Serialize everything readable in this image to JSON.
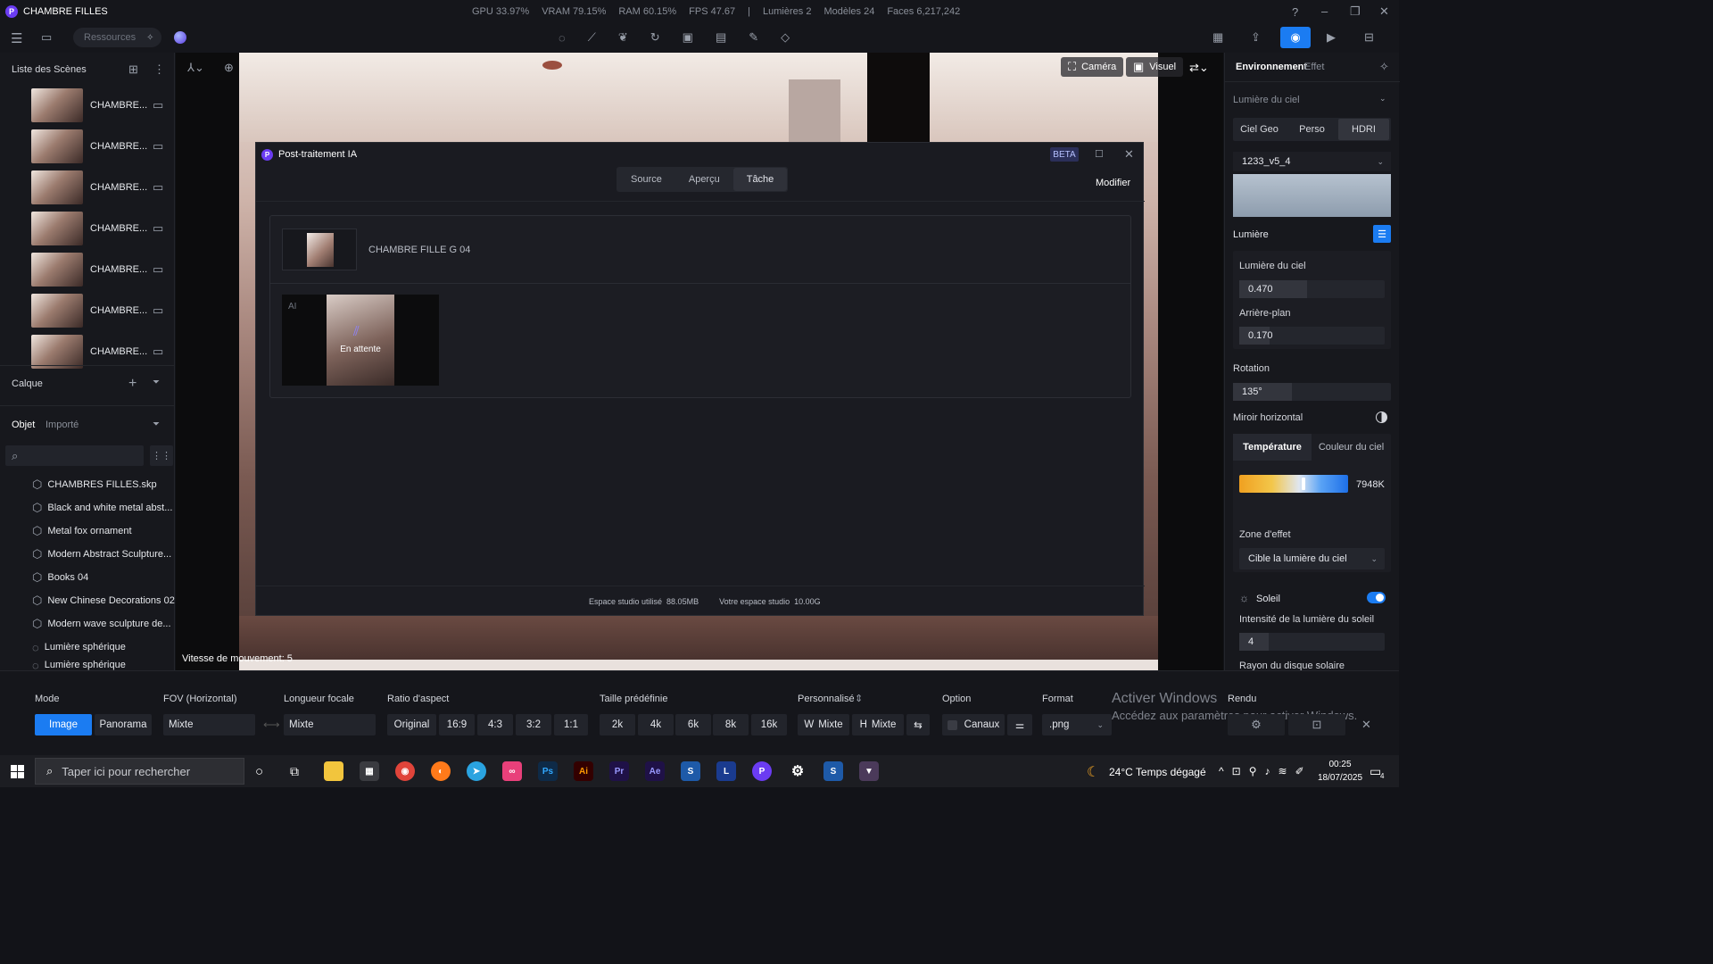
{
  "app": {
    "title": "CHAMBRE FILLES",
    "logo": "P"
  },
  "stats": {
    "gpu": "GPU 33.97%",
    "vram": "VRAM 79.15%",
    "ram": "RAM 60.15%",
    "fps": "FPS 47.67",
    "sep": "|",
    "lights": "Lumières 2",
    "models": "Modèles 24",
    "faces": "Faces 6,217,242"
  },
  "toolbar": {
    "resources_placeholder": "Ressources"
  },
  "scenes": {
    "title": "Liste des Scènes",
    "items": [
      "CHAMBRE...",
      "CHAMBRE...",
      "CHAMBRE...",
      "CHAMBRE...",
      "CHAMBRE...",
      "CHAMBRE...",
      "CHAMBRE..."
    ]
  },
  "layer": {
    "title": "Calque"
  },
  "objects": {
    "tab_object": "Objet",
    "tab_imported": "Importé",
    "items": [
      "CHAMBRES FILLES.skp",
      "Black and white metal abst...",
      "Metal fox ornament",
      "Modern Abstract Sculpture...",
      "Books 04",
      "New Chinese Decorations 02",
      "Modern wave sculpture de...",
      "Lumière sphérique",
      "Lumière sphérique"
    ]
  },
  "viewport": {
    "camera": "Caméra",
    "visual": "Visuel",
    "speed": "Vitesse de mouvement: 5"
  },
  "modal": {
    "title": "Post-traitement IA",
    "badge": "BETA",
    "tabs": [
      "Source",
      "Aperçu",
      "Tâche"
    ],
    "modify": "Modifier",
    "job_name": "CHAMBRE FILLE G 04",
    "ai_label": "AI",
    "status": "En attente",
    "used_label": "Espace studio utilisé",
    "used_value": "88.05MB",
    "total_label": "Votre espace studio",
    "total_value": "10.00G"
  },
  "env": {
    "tab_env": "Environnement",
    "tab_effect": "Effet",
    "sky_light": "Lumière du ciel",
    "sky_tabs": [
      "Ciel Geo",
      "Perso",
      "HDRI"
    ],
    "hdri_name": "1233_v5_4",
    "light": "Lumière",
    "sky_light_label": "Lumière du ciel",
    "sky_light_value": "0.470",
    "background_label": "Arrière-plan",
    "background_value": "0.170",
    "rotation_label": "Rotation",
    "rotation_value": "135°",
    "mirror": "Miroir horizontal",
    "temp_tab": "Température",
    "sky_color_tab": "Couleur du ciel",
    "temp_value": "7948K",
    "zone_label": "Zone d'effet",
    "zone_value": "Cible la lumière du ciel",
    "sun": "Soleil",
    "sun_intensity_label": "Intensité de la lumière du soleil",
    "sun_intensity_value": "4",
    "sun_disk": "Rayon du disque solaire",
    "accent": "#1b7cf2"
  },
  "bottombar": {
    "mode_label": "Mode",
    "mode_image": "Image",
    "mode_pano": "Panorama",
    "fov_label": "FOV (Horizontal)",
    "fov_value": "Mixte",
    "focal_label": "Longueur focale",
    "focal_value": "Mixte",
    "ratio_label": "Ratio d'aspect",
    "ratios": [
      "Original",
      "16:9",
      "4:3",
      "3:2",
      "1:1"
    ],
    "preset_label": "Taille prédéfinie",
    "presets": [
      "2k",
      "4k",
      "6k",
      "8k",
      "16k"
    ],
    "custom_label": "Personnalisé",
    "w": "W",
    "w_value": "Mixte",
    "h": "H",
    "h_value": "Mixte",
    "option_label": "Option",
    "channels": "Canaux",
    "format_label": "Format",
    "format_value": ".png",
    "render_label": "Rendu",
    "activate_title": "Activer Windows",
    "activate_sub": "Accédez aux paramètres pour activer Windows."
  },
  "taskbar": {
    "search_placeholder": "Taper ici pour rechercher",
    "weather": "24°C  Temps dégagé",
    "time": "00:25",
    "date": "18/07/2025",
    "notif": "4"
  }
}
